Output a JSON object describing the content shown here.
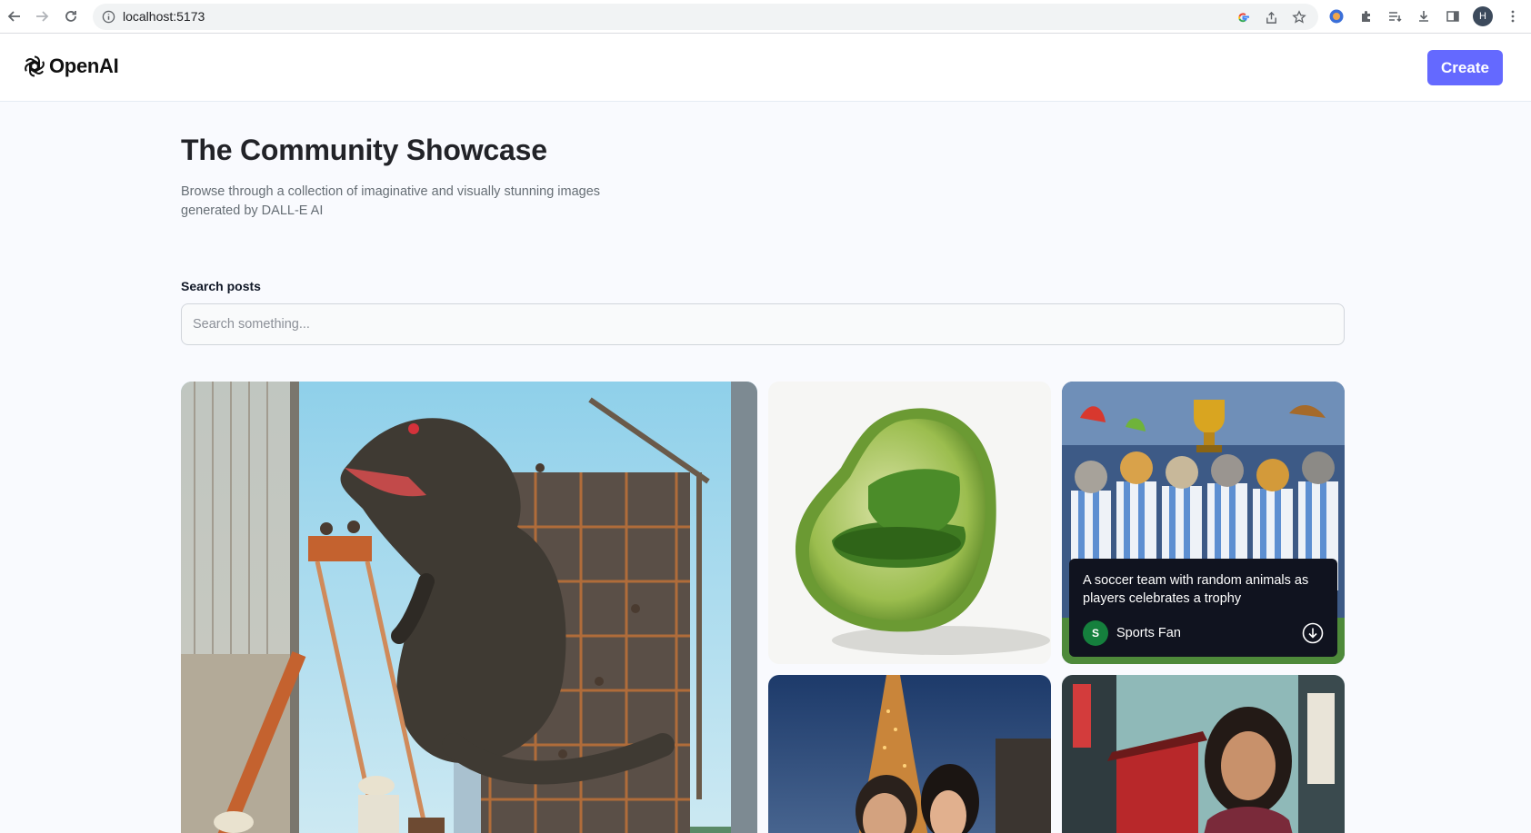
{
  "browser": {
    "url": "localhost:5173",
    "profile_initial": "H"
  },
  "header": {
    "logo_text": "OpenAI",
    "create_label": "Create"
  },
  "main": {
    "title": "The Community Showcase",
    "subtitle": "Browse through a collection of imaginative and visually stunning images generated by DALL-E AI",
    "search_label": "Search posts",
    "search_placeholder": "Search something..."
  },
  "posts": [
    {
      "image": "komodo-dragon-construction",
      "prompt": "",
      "author": ""
    },
    {
      "image": "avocado-armchair",
      "prompt": "",
      "author": ""
    },
    {
      "image": "soccer-animals-trophy",
      "prompt": "A soccer team with random animals as players celebrates a trophy",
      "author": "Sports Fan",
      "author_initial": "S"
    },
    {
      "image": "couple-eiffel-tower",
      "prompt": "",
      "author": ""
    },
    {
      "image": "girl-tokyo-street",
      "prompt": "",
      "author": ""
    }
  ],
  "colors": {
    "accent": "#6469ff",
    "background": "#f9fafe",
    "overlay": "#10131f",
    "avatar": "#15803d"
  }
}
